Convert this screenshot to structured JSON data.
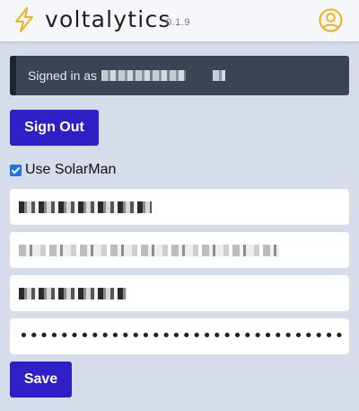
{
  "header": {
    "app_name": "voltalytics",
    "version": "0.1.9",
    "logo_icon": "lightning-bolt-icon",
    "account_icon": "user-circle-icon",
    "accent_color": "#f2b01e"
  },
  "auth": {
    "signed_in_label": "Signed in as",
    "sign_out_label": "Sign Out"
  },
  "solarman": {
    "checkbox_label": "Use SolarMan",
    "checked": true
  },
  "form": {
    "password_value": "••••••••••••••••••••••••••••••••••••••••••••••••••••",
    "save_label": "Save"
  },
  "colors": {
    "primary_button": "#2f1fc6",
    "banner_bg": "#3a4454",
    "page_bg": "#d7dcea"
  }
}
